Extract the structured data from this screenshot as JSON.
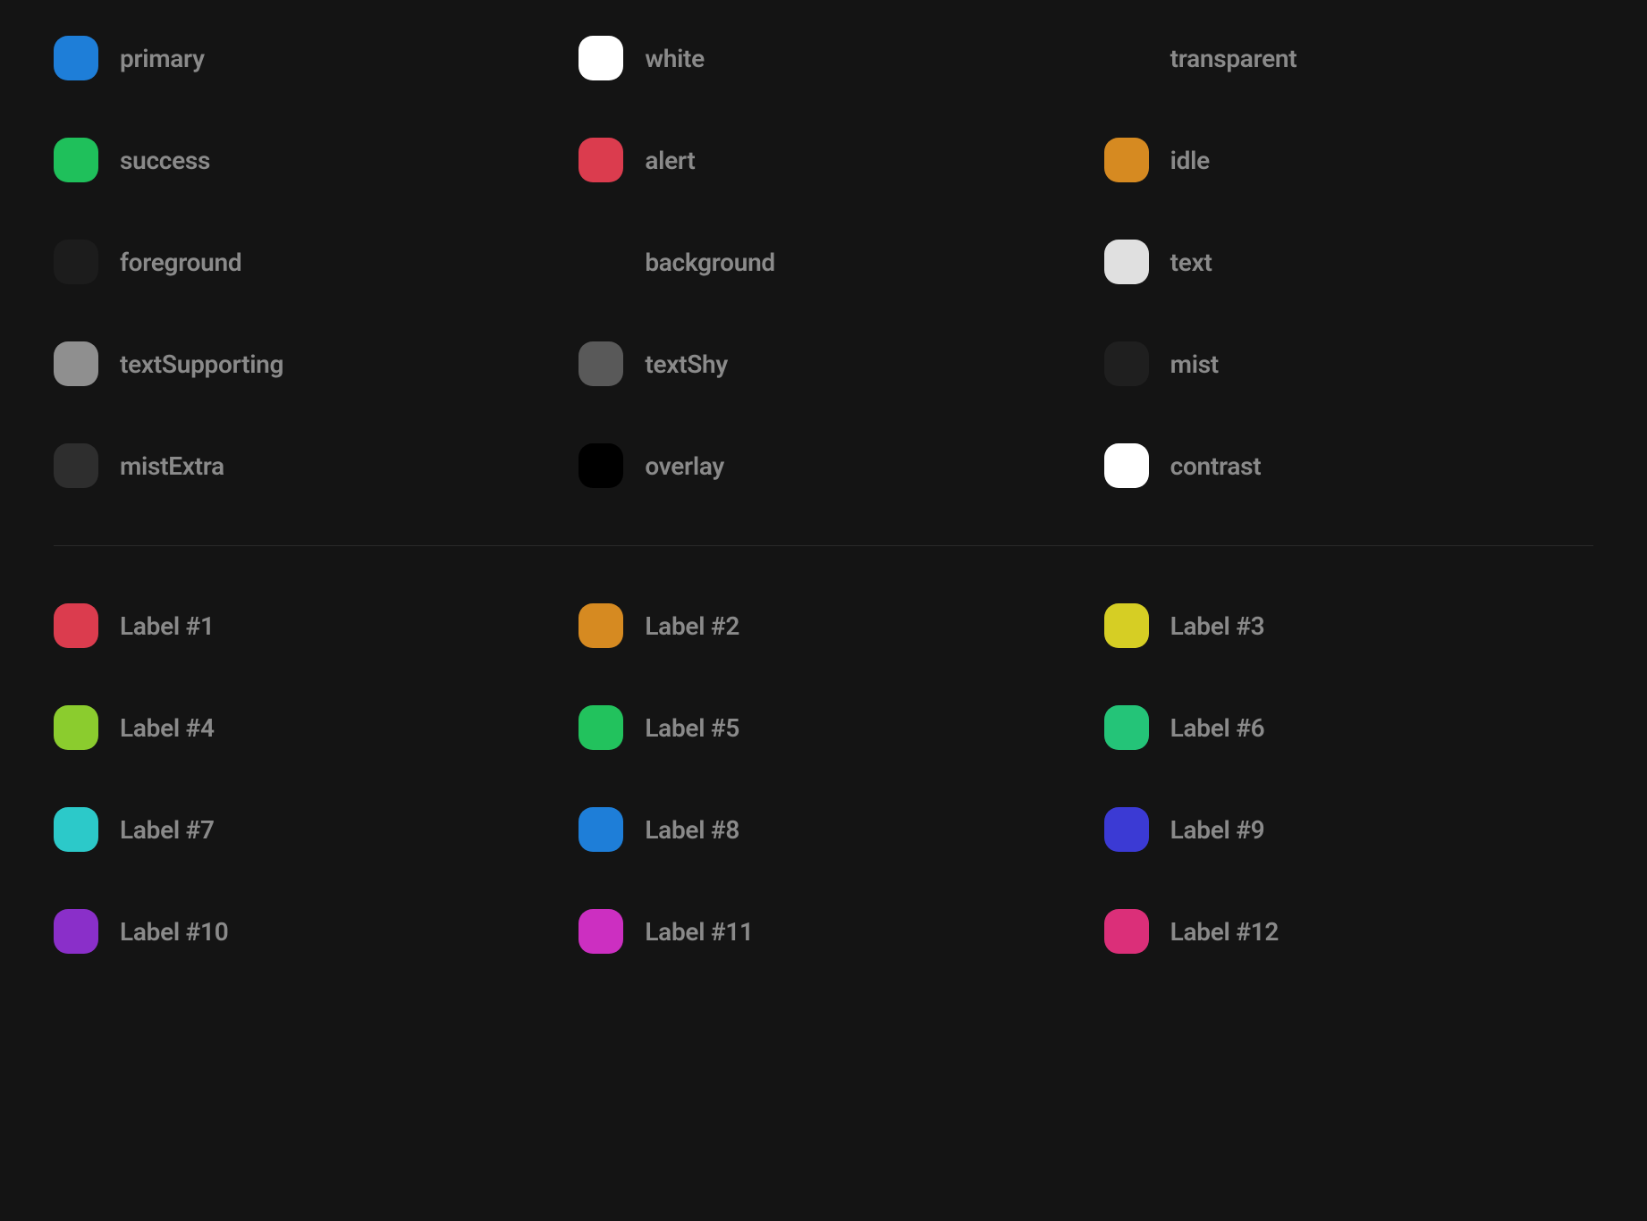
{
  "themeColors": [
    {
      "name": "primary",
      "color": "#1e7ed8"
    },
    {
      "name": "white",
      "color": "#ffffff"
    },
    {
      "name": "transparent",
      "color": "transparent"
    },
    {
      "name": "success",
      "color": "#1fc05b"
    },
    {
      "name": "alert",
      "color": "#db3c4e"
    },
    {
      "name": "idle",
      "color": "#d68a21"
    },
    {
      "name": "foreground",
      "color": "#1c1c1c"
    },
    {
      "name": "background",
      "color": "transparent"
    },
    {
      "name": "text",
      "color": "#e0e0e0"
    },
    {
      "name": "textSupporting",
      "color": "#8f8f8f"
    },
    {
      "name": "textShy",
      "color": "#595959"
    },
    {
      "name": "mist",
      "color": "#1f1f1f"
    },
    {
      "name": "mistExtra",
      "color": "#2e2e2e"
    },
    {
      "name": "overlay",
      "color": "#000000"
    },
    {
      "name": "contrast",
      "color": "#ffffff"
    }
  ],
  "labelColors": [
    {
      "name": "Label #1",
      "color": "#db3c4e"
    },
    {
      "name": "Label #2",
      "color": "#d68a21"
    },
    {
      "name": "Label #3",
      "color": "#d6ce24"
    },
    {
      "name": "Label #4",
      "color": "#8bcc2e"
    },
    {
      "name": "Label #5",
      "color": "#22c25d"
    },
    {
      "name": "Label #6",
      "color": "#24c478"
    },
    {
      "name": "Label #7",
      "color": "#2cc9c9"
    },
    {
      "name": "Label #8",
      "color": "#1e7ed8"
    },
    {
      "name": "Label #9",
      "color": "#3b3ad4"
    },
    {
      "name": "Label #10",
      "color": "#8a2fc9"
    },
    {
      "name": "Label #11",
      "color": "#cc2fc1"
    },
    {
      "name": "Label #12",
      "color": "#db2f79"
    }
  ]
}
